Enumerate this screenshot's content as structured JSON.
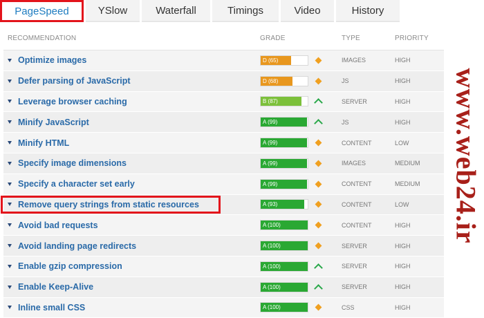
{
  "tabs": [
    {
      "label": "PageSpeed",
      "active": true
    },
    {
      "label": "YSlow",
      "active": false
    },
    {
      "label": "Waterfall",
      "active": false
    },
    {
      "label": "Timings",
      "active": false
    },
    {
      "label": "Video",
      "active": false
    },
    {
      "label": "History",
      "active": false
    }
  ],
  "columns": {
    "recommendation": "RECOMMENDATION",
    "grade": "GRADE",
    "type": "TYPE",
    "priority": "PRIORITY"
  },
  "colors": {
    "grade_d": "#e8971e",
    "grade_b": "#7cc03a",
    "grade_a": "#2aa833",
    "diamond": "#f0a020",
    "chevron": "#2aa84a",
    "highlight": "#e3141b"
  },
  "rows": [
    {
      "label": "Optimize images",
      "grade_text": "D (65)",
      "score": 65,
      "grade_letter": "D",
      "icon": "diamond-icon",
      "type": "IMAGES",
      "priority": "HIGH"
    },
    {
      "label": "Defer parsing of JavaScript",
      "grade_text": "D (68)",
      "score": 68,
      "grade_letter": "D",
      "icon": "diamond-icon",
      "type": "JS",
      "priority": "HIGH"
    },
    {
      "label": "Leverage browser caching",
      "grade_text": "B (87)",
      "score": 87,
      "grade_letter": "B",
      "icon": "chevron-up-icon",
      "type": "SERVER",
      "priority": "HIGH"
    },
    {
      "label": "Minify JavaScript",
      "grade_text": "A (99)",
      "score": 99,
      "grade_letter": "A",
      "icon": "chevron-up-icon",
      "type": "JS",
      "priority": "HIGH"
    },
    {
      "label": "Minify HTML",
      "grade_text": "A (99)",
      "score": 99,
      "grade_letter": "A",
      "icon": "diamond-icon",
      "type": "CONTENT",
      "priority": "LOW"
    },
    {
      "label": "Specify image dimensions",
      "grade_text": "A (99)",
      "score": 99,
      "grade_letter": "A",
      "icon": "diamond-icon",
      "type": "IMAGES",
      "priority": "MEDIUM"
    },
    {
      "label": "Specify a character set early",
      "grade_text": "A (99)",
      "score": 99,
      "grade_letter": "A",
      "icon": "diamond-icon",
      "type": "CONTENT",
      "priority": "MEDIUM"
    },
    {
      "label": "Remove query strings from static resources",
      "grade_text": "A (93)",
      "score": 93,
      "grade_letter": "A",
      "icon": "diamond-icon",
      "type": "CONTENT",
      "priority": "LOW",
      "highlighted": true
    },
    {
      "label": "Avoid bad requests",
      "grade_text": "A (100)",
      "score": 100,
      "grade_letter": "A",
      "icon": "diamond-icon",
      "type": "CONTENT",
      "priority": "HIGH"
    },
    {
      "label": "Avoid landing page redirects",
      "grade_text": "A (100)",
      "score": 100,
      "grade_letter": "A",
      "icon": "diamond-icon",
      "type": "SERVER",
      "priority": "HIGH"
    },
    {
      "label": "Enable gzip compression",
      "grade_text": "A (100)",
      "score": 100,
      "grade_letter": "A",
      "icon": "chevron-up-icon",
      "type": "SERVER",
      "priority": "HIGH"
    },
    {
      "label": "Enable Keep-Alive",
      "grade_text": "A (100)",
      "score": 100,
      "grade_letter": "A",
      "icon": "chevron-up-icon",
      "type": "SERVER",
      "priority": "HIGH"
    },
    {
      "label": "Inline small CSS",
      "grade_text": "A (100)",
      "score": 100,
      "grade_letter": "A",
      "icon": "diamond-icon",
      "type": "CSS",
      "priority": "HIGH"
    }
  ],
  "watermark": {
    "text": "www.web24.ir"
  }
}
